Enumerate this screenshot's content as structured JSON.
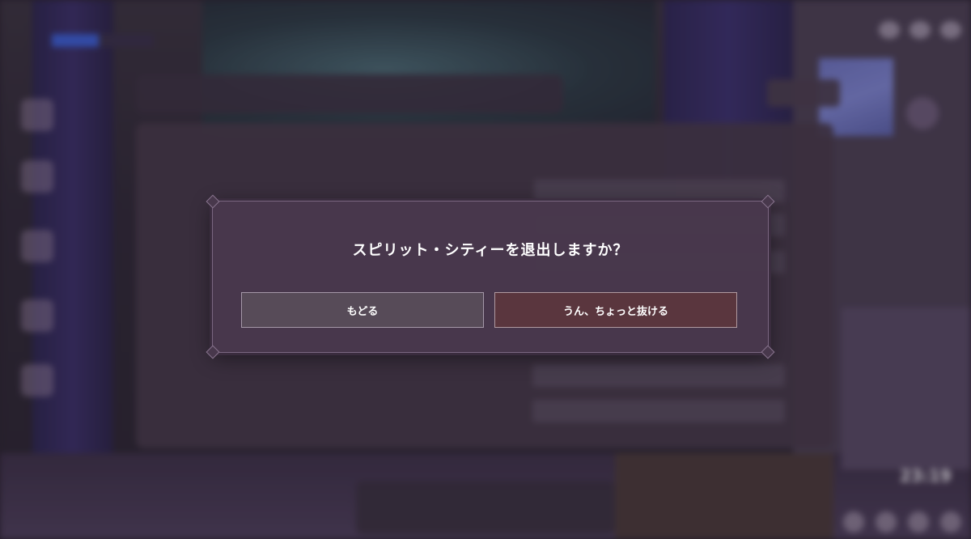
{
  "dialog": {
    "title": "スピリット・シティーを退出しますか？",
    "back_label": "もどる",
    "exit_label": "うん、ちょっと抜ける"
  },
  "background": {
    "clock_time": "23:19"
  },
  "colors": {
    "dialog_bg": "#48384c",
    "back_button": "#574b58",
    "exit_button": "#5a363e",
    "progress_fill": "#3b5fd8"
  }
}
